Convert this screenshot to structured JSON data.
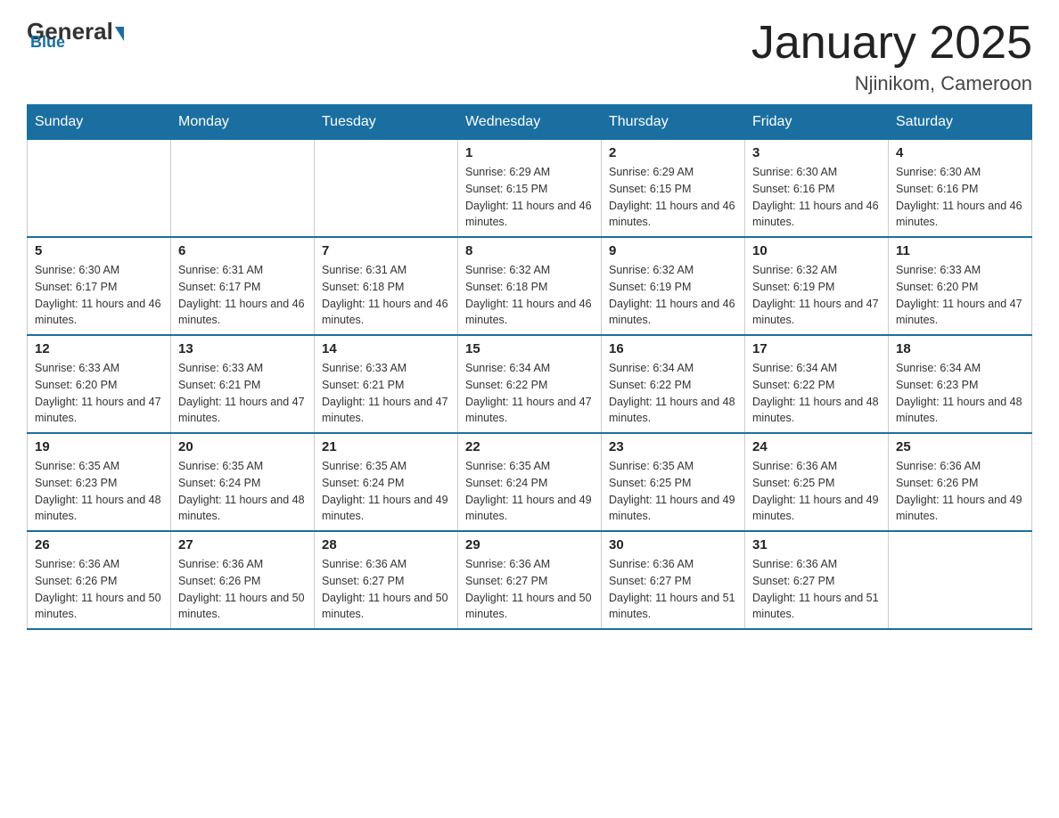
{
  "header": {
    "logo_general": "General",
    "logo_blue": "Blue",
    "title": "January 2025",
    "subtitle": "Njinikom, Cameroon"
  },
  "weekdays": [
    "Sunday",
    "Monday",
    "Tuesday",
    "Wednesday",
    "Thursday",
    "Friday",
    "Saturday"
  ],
  "weeks": [
    [
      {
        "day": "",
        "info": ""
      },
      {
        "day": "",
        "info": ""
      },
      {
        "day": "",
        "info": ""
      },
      {
        "day": "1",
        "info": "Sunrise: 6:29 AM\nSunset: 6:15 PM\nDaylight: 11 hours and 46 minutes."
      },
      {
        "day": "2",
        "info": "Sunrise: 6:29 AM\nSunset: 6:15 PM\nDaylight: 11 hours and 46 minutes."
      },
      {
        "day": "3",
        "info": "Sunrise: 6:30 AM\nSunset: 6:16 PM\nDaylight: 11 hours and 46 minutes."
      },
      {
        "day": "4",
        "info": "Sunrise: 6:30 AM\nSunset: 6:16 PM\nDaylight: 11 hours and 46 minutes."
      }
    ],
    [
      {
        "day": "5",
        "info": "Sunrise: 6:30 AM\nSunset: 6:17 PM\nDaylight: 11 hours and 46 minutes."
      },
      {
        "day": "6",
        "info": "Sunrise: 6:31 AM\nSunset: 6:17 PM\nDaylight: 11 hours and 46 minutes."
      },
      {
        "day": "7",
        "info": "Sunrise: 6:31 AM\nSunset: 6:18 PM\nDaylight: 11 hours and 46 minutes."
      },
      {
        "day": "8",
        "info": "Sunrise: 6:32 AM\nSunset: 6:18 PM\nDaylight: 11 hours and 46 minutes."
      },
      {
        "day": "9",
        "info": "Sunrise: 6:32 AM\nSunset: 6:19 PM\nDaylight: 11 hours and 46 minutes."
      },
      {
        "day": "10",
        "info": "Sunrise: 6:32 AM\nSunset: 6:19 PM\nDaylight: 11 hours and 47 minutes."
      },
      {
        "day": "11",
        "info": "Sunrise: 6:33 AM\nSunset: 6:20 PM\nDaylight: 11 hours and 47 minutes."
      }
    ],
    [
      {
        "day": "12",
        "info": "Sunrise: 6:33 AM\nSunset: 6:20 PM\nDaylight: 11 hours and 47 minutes."
      },
      {
        "day": "13",
        "info": "Sunrise: 6:33 AM\nSunset: 6:21 PM\nDaylight: 11 hours and 47 minutes."
      },
      {
        "day": "14",
        "info": "Sunrise: 6:33 AM\nSunset: 6:21 PM\nDaylight: 11 hours and 47 minutes."
      },
      {
        "day": "15",
        "info": "Sunrise: 6:34 AM\nSunset: 6:22 PM\nDaylight: 11 hours and 47 minutes."
      },
      {
        "day": "16",
        "info": "Sunrise: 6:34 AM\nSunset: 6:22 PM\nDaylight: 11 hours and 48 minutes."
      },
      {
        "day": "17",
        "info": "Sunrise: 6:34 AM\nSunset: 6:22 PM\nDaylight: 11 hours and 48 minutes."
      },
      {
        "day": "18",
        "info": "Sunrise: 6:34 AM\nSunset: 6:23 PM\nDaylight: 11 hours and 48 minutes."
      }
    ],
    [
      {
        "day": "19",
        "info": "Sunrise: 6:35 AM\nSunset: 6:23 PM\nDaylight: 11 hours and 48 minutes."
      },
      {
        "day": "20",
        "info": "Sunrise: 6:35 AM\nSunset: 6:24 PM\nDaylight: 11 hours and 48 minutes."
      },
      {
        "day": "21",
        "info": "Sunrise: 6:35 AM\nSunset: 6:24 PM\nDaylight: 11 hours and 49 minutes."
      },
      {
        "day": "22",
        "info": "Sunrise: 6:35 AM\nSunset: 6:24 PM\nDaylight: 11 hours and 49 minutes."
      },
      {
        "day": "23",
        "info": "Sunrise: 6:35 AM\nSunset: 6:25 PM\nDaylight: 11 hours and 49 minutes."
      },
      {
        "day": "24",
        "info": "Sunrise: 6:36 AM\nSunset: 6:25 PM\nDaylight: 11 hours and 49 minutes."
      },
      {
        "day": "25",
        "info": "Sunrise: 6:36 AM\nSunset: 6:26 PM\nDaylight: 11 hours and 49 minutes."
      }
    ],
    [
      {
        "day": "26",
        "info": "Sunrise: 6:36 AM\nSunset: 6:26 PM\nDaylight: 11 hours and 50 minutes."
      },
      {
        "day": "27",
        "info": "Sunrise: 6:36 AM\nSunset: 6:26 PM\nDaylight: 11 hours and 50 minutes."
      },
      {
        "day": "28",
        "info": "Sunrise: 6:36 AM\nSunset: 6:27 PM\nDaylight: 11 hours and 50 minutes."
      },
      {
        "day": "29",
        "info": "Sunrise: 6:36 AM\nSunset: 6:27 PM\nDaylight: 11 hours and 50 minutes."
      },
      {
        "day": "30",
        "info": "Sunrise: 6:36 AM\nSunset: 6:27 PM\nDaylight: 11 hours and 51 minutes."
      },
      {
        "day": "31",
        "info": "Sunrise: 6:36 AM\nSunset: 6:27 PM\nDaylight: 11 hours and 51 minutes."
      },
      {
        "day": "",
        "info": ""
      }
    ]
  ]
}
